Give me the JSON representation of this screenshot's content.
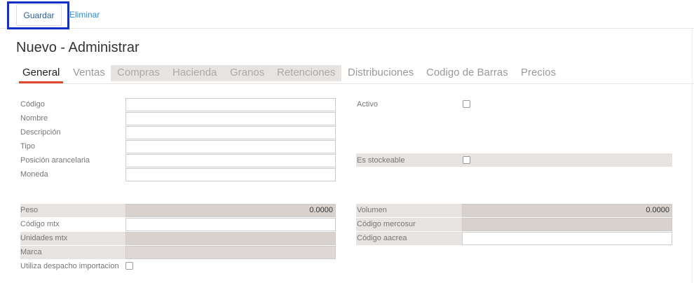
{
  "toolbar": {
    "save_label": "Guardar",
    "delete_label": "Eliminar"
  },
  "page": {
    "title": "Nuevo - Administrar"
  },
  "tabs": [
    {
      "label": "General"
    },
    {
      "label": "Ventas"
    },
    {
      "label": "Compras"
    },
    {
      "label": "Hacienda"
    },
    {
      "label": "Granos"
    },
    {
      "label": "Retenciones"
    },
    {
      "label": "Distribuciones"
    },
    {
      "label": "Codigo de Barras"
    },
    {
      "label": "Precios"
    }
  ],
  "left_fields": {
    "codigo": "Código",
    "nombre": "Nombre",
    "descripcion": "Descripción",
    "tipo": "Tipo",
    "posicion": "Posición arancelaria",
    "moneda": "Moneda"
  },
  "right_fields": {
    "activo": "Activo",
    "stockeable": "Es stockeable"
  },
  "lower_left": {
    "peso_label": "Peso",
    "peso_value": "0.0000",
    "codigo_mtx_label": "Código mtx",
    "unidades_mtx_label": "Unidades mtx",
    "marca_label": "Marca",
    "despacho_label": "Utiliza despacho importacion"
  },
  "lower_right": {
    "volumen_label": "Volumen",
    "volumen_value": "0.0000",
    "mercosur_label": "Código mercosur",
    "aacrea_label": "Código aacrea"
  }
}
